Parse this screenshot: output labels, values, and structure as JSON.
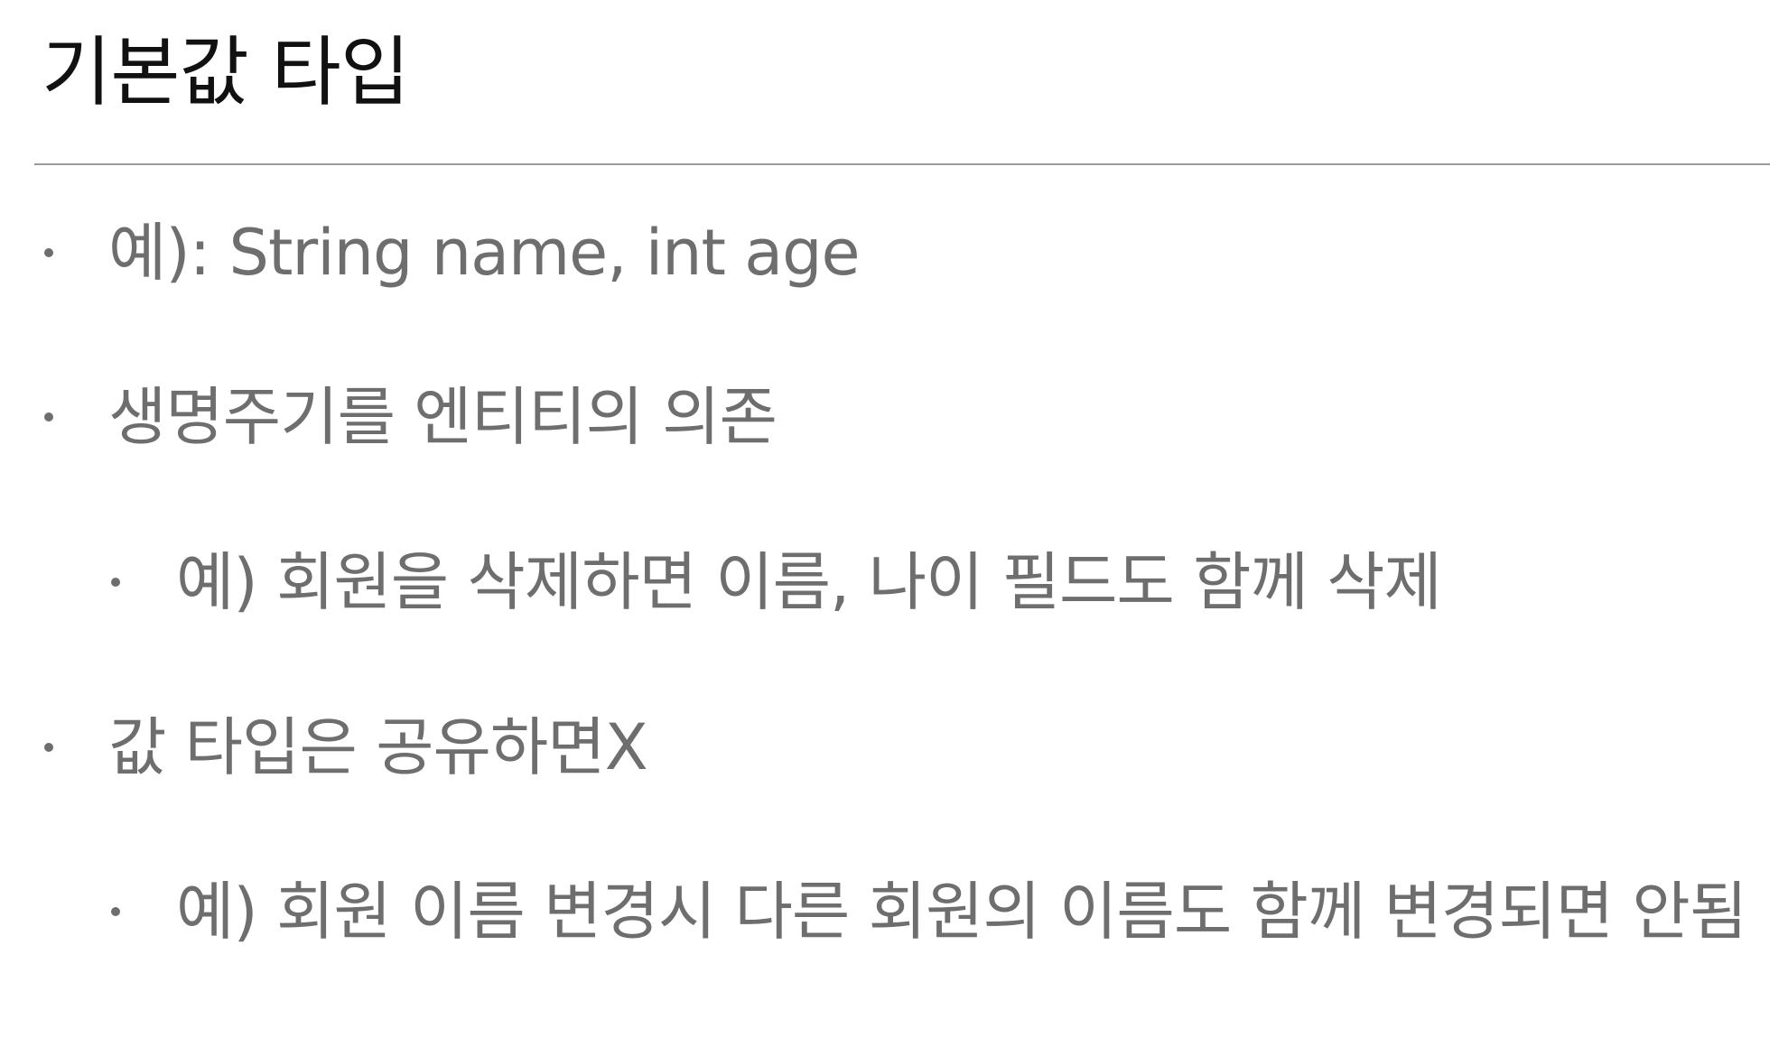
{
  "slide": {
    "title": "기본값 타입",
    "bullets": [
      {
        "level": 1,
        "text": "예): String name, int age"
      },
      {
        "level": 1,
        "text": "생명주기를 엔티티의 의존"
      },
      {
        "level": 2,
        "text": "예) 회원을 삭제하면 이름, 나이 필드도 함께 삭제"
      },
      {
        "level": 1,
        "text": "값 타입은 공유하면X"
      },
      {
        "level": 2,
        "text": "예) 회원 이름 변경시 다른 회원의 이름도 함께 변경되면 안됨"
      }
    ]
  }
}
